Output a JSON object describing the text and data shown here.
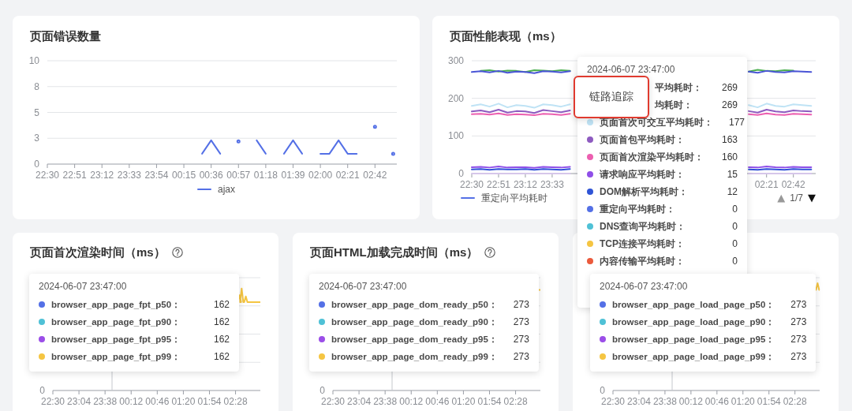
{
  "panel_rows": [
    [
      {
        "title": "页面错误数量",
        "chart_data": {
          "type": "line",
          "grid": true,
          "ylim": [
            0,
            10
          ],
          "yticks": [
            0,
            {
              "value": 2.5,
              "label": "3"
            },
            5,
            {
              "value": 7.5,
              "label": "8"
            },
            10
          ],
          "categories": [
            "22:30",
            null,
            null,
            "22:51",
            null,
            null,
            "23:12",
            null,
            null,
            "23:33",
            null,
            null,
            "23:54",
            null,
            null,
            "00:15",
            null,
            null,
            "00:36",
            null,
            null,
            "00:57",
            null,
            null,
            "01:18",
            null,
            null,
            "01:39",
            null,
            null,
            "02:00",
            null,
            null,
            "02:21",
            null,
            null,
            "02:42",
            null,
            null
          ],
          "series": [
            {
              "color": "#5470e6",
              "values": [
                null,
                null,
                null,
                null,
                null,
                null,
                null,
                null,
                null,
                null,
                null,
                null,
                null,
                null,
                null,
                null,
                null,
                1,
                2.3,
                1,
                null,
                2.2,
                null,
                2.3,
                1,
                null,
                1,
                2.3,
                1,
                null,
                1,
                1,
                2.3,
                1,
                1,
                null,
                3.6,
                null,
                1
              ]
            }
          ]
        },
        "legend": [
          {
            "label": "ajax",
            "color": "#5470e6"
          }
        ]
      },
      {
        "title": "页面性能表现（ms）",
        "chart_data": {
          "type": "line",
          "grid": true,
          "ylim": [
            0,
            300
          ],
          "yticks": [
            0,
            100,
            200,
            300
          ],
          "categories": [
            "22:30",
            null,
            null,
            "22:51",
            null,
            null,
            "23:12",
            null,
            null,
            "23:33",
            null,
            null,
            null,
            null,
            null,
            null,
            null,
            null,
            null,
            null,
            null,
            null,
            null,
            null,
            null,
            null,
            null,
            null,
            null,
            null,
            null,
            null,
            null,
            "02:21",
            null,
            null,
            "02:42",
            null,
            null
          ],
          "series": [
            {
              "color": "#4caf50",
              "values": [
                null,
                273,
                275,
                271,
                274,
                273,
                270,
                275,
                274,
                272,
                275,
                273,
                null,
                null,
                null,
                null,
                null,
                null,
                null,
                null,
                null,
                null,
                null,
                null,
                null,
                null,
                null,
                null,
                null,
                null,
                null,
                271,
                276,
                273,
                272,
                275,
                274,
                null,
                null
              ]
            },
            {
              "color": "#4a55d6",
              "values": [
                270,
                272,
                269,
                273,
                268,
                271,
                270,
                267,
                272,
                271,
                269,
                272,
                null,
                null,
                null,
                null,
                null,
                null,
                null,
                null,
                null,
                null,
                null,
                null,
                null,
                null,
                null,
                null,
                null,
                null,
                null,
                271,
                268,
                273,
                270,
                269,
                272,
                271,
                270
              ]
            },
            {
              "color": "#bfe3f5",
              "values": [
                180,
                184,
                178,
                186,
                176,
                182,
                180,
                175,
                184,
                182,
                178,
                184,
                null,
                null,
                null,
                null,
                null,
                null,
                null,
                null,
                null,
                null,
                null,
                null,
                null,
                null,
                null,
                null,
                null,
                null,
                null,
                182,
                176,
                186,
                180,
                178,
                184,
                182,
                180
              ]
            },
            {
              "color": "#8e5bc0",
              "values": [
                165,
                168,
                163,
                170,
                162,
                166,
                165,
                161,
                169,
                166,
                163,
                168,
                null,
                null,
                null,
                null,
                null,
                null,
                null,
                null,
                null,
                null,
                null,
                null,
                null,
                null,
                null,
                null,
                null,
                null,
                null,
                166,
                162,
                170,
                165,
                163,
                168,
                166,
                165
              ]
            },
            {
              "color": "#ec5fb0",
              "values": [
                158,
                159,
                157,
                160,
                156,
                158,
                157,
                155,
                159,
                158,
                156,
                159,
                null,
                null,
                null,
                null,
                null,
                null,
                null,
                null,
                null,
                null,
                null,
                null,
                null,
                null,
                null,
                null,
                null,
                null,
                null,
                158,
                156,
                160,
                157,
                156,
                159,
                158,
                157
              ]
            },
            {
              "color": "#8f4ee8",
              "values": [
                17,
                18,
                16,
                19,
                16,
                17,
                17,
                15,
                18,
                17,
                16,
                18,
                null,
                null,
                null,
                null,
                null,
                null,
                null,
                null,
                null,
                null,
                null,
                null,
                null,
                null,
                null,
                null,
                null,
                null,
                null,
                17,
                16,
                19,
                17,
                16,
                18,
                17,
                17
              ]
            },
            {
              "color": "#3050d8",
              "values": [
                11,
                12,
                10,
                12,
                11,
                11,
                12,
                10,
                12,
                11,
                10,
                12,
                null,
                null,
                null,
                null,
                null,
                null,
                null,
                null,
                null,
                null,
                null,
                null,
                null,
                null,
                null,
                null,
                null,
                null,
                null,
                11,
                10,
                12,
                11,
                10,
                12,
                11,
                11
              ]
            },
            {
              "color": "#d6c6ea",
              "values": [
                0,
                0,
                0,
                0,
                0,
                0,
                0,
                0,
                0,
                0,
                0,
                0,
                null,
                null,
                null,
                null,
                null,
                null,
                null,
                null,
                null,
                null,
                null,
                null,
                null,
                null,
                null,
                null,
                null,
                null,
                null,
                0,
                0,
                0,
                0,
                0,
                0,
                0,
                0
              ]
            }
          ]
        },
        "legend": [
          {
            "label": "重定向平均耗时",
            "color": "#5470e6"
          }
        ],
        "pager": {
          "prev": {
            "label": "▲",
            "disabled": true
          },
          "page": "1/7",
          "next": {
            "label": "▼",
            "disabled": false
          }
        },
        "tooltip": {
          "time": "2024-06-07 23:47:00",
          "rows": [
            {
              "kind": "partial",
              "label": "平均耗时：",
              "value": "269"
            },
            {
              "kind": "partial",
              "label": "均耗时：",
              "value": "269"
            },
            {
              "kind": "metric",
              "label": "页面首次可交互平均耗时：",
              "value": "177",
              "color": "#bfe3f5"
            },
            {
              "kind": "metric",
              "label": "页面首包平均耗时：",
              "value": "163",
              "color": "#8e5bc0"
            },
            {
              "kind": "metric",
              "label": "页面首次渲染平均耗时：",
              "value": "160",
              "color": "#ec5fb0"
            },
            {
              "kind": "metric",
              "label": "请求响应平均耗时：",
              "value": "15",
              "color": "#8f4ee8"
            },
            {
              "kind": "metric",
              "label": "DOM解析平均耗时：",
              "value": "12",
              "color": "#2f54d6"
            },
            {
              "kind": "metric",
              "label": "重定向平均耗时：",
              "value": "0",
              "color": "#5470e6"
            },
            {
              "kind": "metric",
              "label": "DNS查询平均耗时：",
              "value": "0",
              "color": "#4fc1d6"
            },
            {
              "kind": "metric",
              "label": "TCP连接平均耗时：",
              "value": "0",
              "color": "#f5c542"
            },
            {
              "kind": "metric",
              "label": "内容传输平均耗时：",
              "value": "0",
              "color": "#eb5a3c"
            }
          ]
        },
        "popup": {
          "label": "链路追踪",
          "highlighted": true
        }
      }
    ],
    [
      {
        "title": "页面首次渲染时间（ms）",
        "help": true,
        "axis": {
          "y_labels": [
            "0"
          ],
          "x_labels": [
            "22:30",
            "23:04",
            "23:38",
            "00:12",
            "00:46",
            "01:20",
            "01:54",
            "02:28"
          ]
        },
        "tooltip": {
          "time": "2024-06-07 23:47:00",
          "rows": [
            {
              "kind": "metric",
              "label": "browser_app_page_fpt_p50：",
              "value": "162",
              "color": "#5470e6"
            },
            {
              "kind": "metric",
              "label": "browser_app_page_fpt_p90：",
              "value": "162",
              "color": "#4fc1d6"
            },
            {
              "kind": "metric",
              "label": "browser_app_page_fpt_p95：",
              "value": "162",
              "color": "#9b4ee8"
            },
            {
              "kind": "metric",
              "label": "browser_app_page_fpt_p99：",
              "value": "162",
              "color": "#f5c542"
            }
          ]
        }
      },
      {
        "title": "页面HTML加载完成时间（ms）",
        "help": true,
        "axis": {
          "y_labels": [
            "0"
          ],
          "x_labels": [
            "22:30",
            "23:04",
            "23:38",
            "00:12",
            "00:46",
            "01:20",
            "01:54",
            "02:28"
          ]
        },
        "tooltip": {
          "time": "2024-06-07 23:47:00",
          "rows": [
            {
              "kind": "metric",
              "label": "browser_app_page_dom_ready_p50：",
              "value": "273",
              "color": "#5470e6"
            },
            {
              "kind": "metric",
              "label": "browser_app_page_dom_ready_p90：",
              "value": "273",
              "color": "#4fc1d6"
            },
            {
              "kind": "metric",
              "label": "browser_app_page_dom_ready_p95：",
              "value": "273",
              "color": "#9b4ee8"
            },
            {
              "kind": "metric",
              "label": "browser_app_page_dom_ready_p99：",
              "value": "273",
              "color": "#f5c542"
            }
          ]
        }
      },
      {
        "axis": {
          "y_labels": [
            "0"
          ],
          "x_labels": [
            "22:30",
            "23:04",
            "23:38",
            "00:12",
            "00:46",
            "01:20",
            "01:54",
            "02:28"
          ]
        },
        "tooltip": {
          "time": "2024-06-07 23:47:00",
          "rows": [
            {
              "kind": "metric",
              "label": "browser_app_page_load_page_p50：",
              "value": "273",
              "color": "#5470e6"
            },
            {
              "kind": "metric",
              "label": "browser_app_page_load_page_p90：",
              "value": "273",
              "color": "#4fc1d6"
            },
            {
              "kind": "metric",
              "label": "browser_app_page_load_page_p95：",
              "value": "273",
              "color": "#9b4ee8"
            },
            {
              "kind": "metric",
              "label": "browser_app_page_load_page_p99：",
              "value": "273",
              "color": "#f5c542"
            }
          ]
        }
      }
    ]
  ]
}
